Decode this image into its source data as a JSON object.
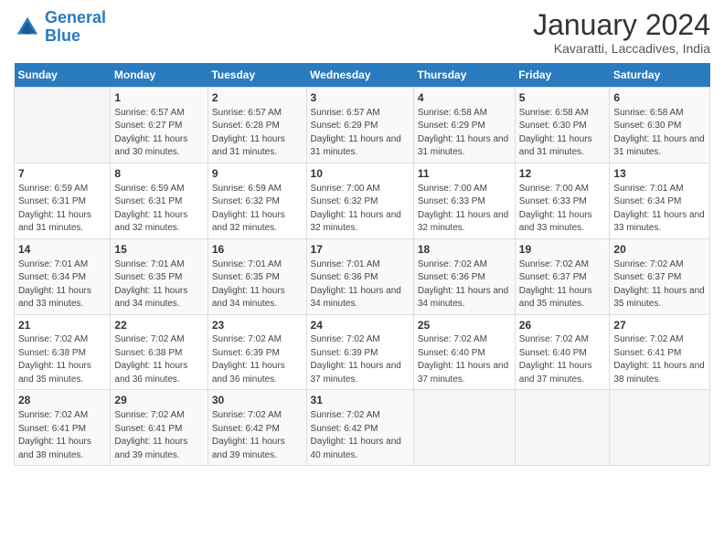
{
  "logo": {
    "line1": "General",
    "line2": "Blue"
  },
  "title": "January 2024",
  "subtitle": "Kavaratti, Laccadives, India",
  "days_of_week": [
    "Sunday",
    "Monday",
    "Tuesday",
    "Wednesday",
    "Thursday",
    "Friday",
    "Saturday"
  ],
  "weeks": [
    [
      {
        "day": "",
        "sunrise": "",
        "sunset": "",
        "daylight": ""
      },
      {
        "day": "1",
        "sunrise": "Sunrise: 6:57 AM",
        "sunset": "Sunset: 6:27 PM",
        "daylight": "Daylight: 11 hours and 30 minutes."
      },
      {
        "day": "2",
        "sunrise": "Sunrise: 6:57 AM",
        "sunset": "Sunset: 6:28 PM",
        "daylight": "Daylight: 11 hours and 31 minutes."
      },
      {
        "day": "3",
        "sunrise": "Sunrise: 6:57 AM",
        "sunset": "Sunset: 6:29 PM",
        "daylight": "Daylight: 11 hours and 31 minutes."
      },
      {
        "day": "4",
        "sunrise": "Sunrise: 6:58 AM",
        "sunset": "Sunset: 6:29 PM",
        "daylight": "Daylight: 11 hours and 31 minutes."
      },
      {
        "day": "5",
        "sunrise": "Sunrise: 6:58 AM",
        "sunset": "Sunset: 6:30 PM",
        "daylight": "Daylight: 11 hours and 31 minutes."
      },
      {
        "day": "6",
        "sunrise": "Sunrise: 6:58 AM",
        "sunset": "Sunset: 6:30 PM",
        "daylight": "Daylight: 11 hours and 31 minutes."
      }
    ],
    [
      {
        "day": "7",
        "sunrise": "Sunrise: 6:59 AM",
        "sunset": "Sunset: 6:31 PM",
        "daylight": "Daylight: 11 hours and 31 minutes."
      },
      {
        "day": "8",
        "sunrise": "Sunrise: 6:59 AM",
        "sunset": "Sunset: 6:31 PM",
        "daylight": "Daylight: 11 hours and 32 minutes."
      },
      {
        "day": "9",
        "sunrise": "Sunrise: 6:59 AM",
        "sunset": "Sunset: 6:32 PM",
        "daylight": "Daylight: 11 hours and 32 minutes."
      },
      {
        "day": "10",
        "sunrise": "Sunrise: 7:00 AM",
        "sunset": "Sunset: 6:32 PM",
        "daylight": "Daylight: 11 hours and 32 minutes."
      },
      {
        "day": "11",
        "sunrise": "Sunrise: 7:00 AM",
        "sunset": "Sunset: 6:33 PM",
        "daylight": "Daylight: 11 hours and 32 minutes."
      },
      {
        "day": "12",
        "sunrise": "Sunrise: 7:00 AM",
        "sunset": "Sunset: 6:33 PM",
        "daylight": "Daylight: 11 hours and 33 minutes."
      },
      {
        "day": "13",
        "sunrise": "Sunrise: 7:01 AM",
        "sunset": "Sunset: 6:34 PM",
        "daylight": "Daylight: 11 hours and 33 minutes."
      }
    ],
    [
      {
        "day": "14",
        "sunrise": "Sunrise: 7:01 AM",
        "sunset": "Sunset: 6:34 PM",
        "daylight": "Daylight: 11 hours and 33 minutes."
      },
      {
        "day": "15",
        "sunrise": "Sunrise: 7:01 AM",
        "sunset": "Sunset: 6:35 PM",
        "daylight": "Daylight: 11 hours and 34 minutes."
      },
      {
        "day": "16",
        "sunrise": "Sunrise: 7:01 AM",
        "sunset": "Sunset: 6:35 PM",
        "daylight": "Daylight: 11 hours and 34 minutes."
      },
      {
        "day": "17",
        "sunrise": "Sunrise: 7:01 AM",
        "sunset": "Sunset: 6:36 PM",
        "daylight": "Daylight: 11 hours and 34 minutes."
      },
      {
        "day": "18",
        "sunrise": "Sunrise: 7:02 AM",
        "sunset": "Sunset: 6:36 PM",
        "daylight": "Daylight: 11 hours and 34 minutes."
      },
      {
        "day": "19",
        "sunrise": "Sunrise: 7:02 AM",
        "sunset": "Sunset: 6:37 PM",
        "daylight": "Daylight: 11 hours and 35 minutes."
      },
      {
        "day": "20",
        "sunrise": "Sunrise: 7:02 AM",
        "sunset": "Sunset: 6:37 PM",
        "daylight": "Daylight: 11 hours and 35 minutes."
      }
    ],
    [
      {
        "day": "21",
        "sunrise": "Sunrise: 7:02 AM",
        "sunset": "Sunset: 6:38 PM",
        "daylight": "Daylight: 11 hours and 35 minutes."
      },
      {
        "day": "22",
        "sunrise": "Sunrise: 7:02 AM",
        "sunset": "Sunset: 6:38 PM",
        "daylight": "Daylight: 11 hours and 36 minutes."
      },
      {
        "day": "23",
        "sunrise": "Sunrise: 7:02 AM",
        "sunset": "Sunset: 6:39 PM",
        "daylight": "Daylight: 11 hours and 36 minutes."
      },
      {
        "day": "24",
        "sunrise": "Sunrise: 7:02 AM",
        "sunset": "Sunset: 6:39 PM",
        "daylight": "Daylight: 11 hours and 37 minutes."
      },
      {
        "day": "25",
        "sunrise": "Sunrise: 7:02 AM",
        "sunset": "Sunset: 6:40 PM",
        "daylight": "Daylight: 11 hours and 37 minutes."
      },
      {
        "day": "26",
        "sunrise": "Sunrise: 7:02 AM",
        "sunset": "Sunset: 6:40 PM",
        "daylight": "Daylight: 11 hours and 37 minutes."
      },
      {
        "day": "27",
        "sunrise": "Sunrise: 7:02 AM",
        "sunset": "Sunset: 6:41 PM",
        "daylight": "Daylight: 11 hours and 38 minutes."
      }
    ],
    [
      {
        "day": "28",
        "sunrise": "Sunrise: 7:02 AM",
        "sunset": "Sunset: 6:41 PM",
        "daylight": "Daylight: 11 hours and 38 minutes."
      },
      {
        "day": "29",
        "sunrise": "Sunrise: 7:02 AM",
        "sunset": "Sunset: 6:41 PM",
        "daylight": "Daylight: 11 hours and 39 minutes."
      },
      {
        "day": "30",
        "sunrise": "Sunrise: 7:02 AM",
        "sunset": "Sunset: 6:42 PM",
        "daylight": "Daylight: 11 hours and 39 minutes."
      },
      {
        "day": "31",
        "sunrise": "Sunrise: 7:02 AM",
        "sunset": "Sunset: 6:42 PM",
        "daylight": "Daylight: 11 hours and 40 minutes."
      },
      {
        "day": "",
        "sunrise": "",
        "sunset": "",
        "daylight": ""
      },
      {
        "day": "",
        "sunrise": "",
        "sunset": "",
        "daylight": ""
      },
      {
        "day": "",
        "sunrise": "",
        "sunset": "",
        "daylight": ""
      }
    ]
  ]
}
